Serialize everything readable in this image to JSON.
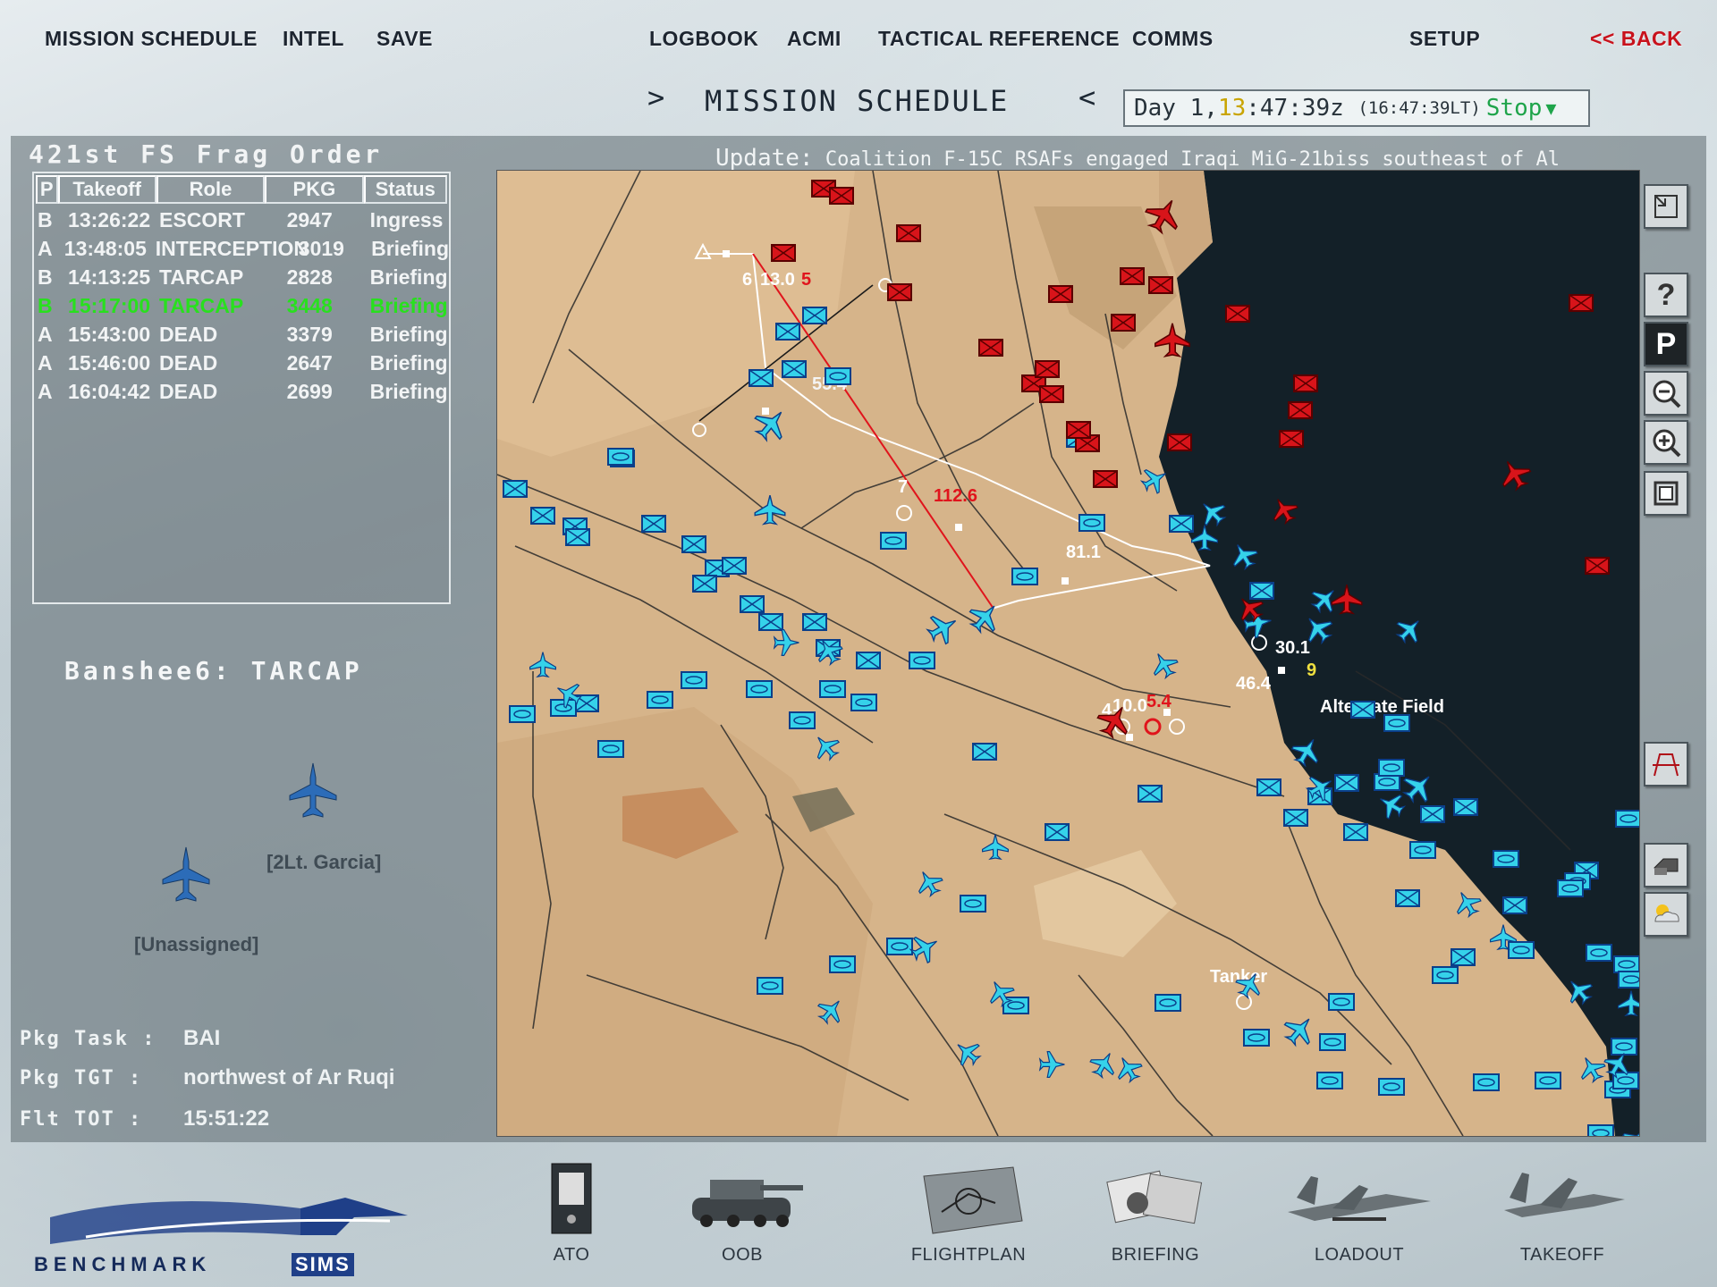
{
  "nav": {
    "mission_schedule": "MISSION SCHEDULE",
    "intel": "INTEL",
    "save": "SAVE",
    "logbook": "LOGBOOK",
    "acmi": "ACMI",
    "tactical_reference": "TACTICAL REFERENCE",
    "comms": "COMMS",
    "setup": "SETUP",
    "back": "<< BACK"
  },
  "screen_title": {
    "left_arrow": ">",
    "title": "MISSION SCHEDULE",
    "right_arrow": "<"
  },
  "clock": {
    "day_label": "Day",
    "day": "1,",
    "hour": "13",
    "rest": ":47:39z",
    "local": "(16:47:39LT)",
    "stop": "Stop"
  },
  "frag": {
    "title": "421st FS Frag Order",
    "headers": [
      "P",
      "Takeoff",
      "Role",
      "PKG",
      "Status"
    ],
    "rows": [
      {
        "p": "B",
        "takeoff": "13:26:22",
        "role": "ESCORT",
        "pkg": "2947",
        "status": "Ingress"
      },
      {
        "p": "A",
        "takeoff": "13:48:05",
        "role": "INTERCEPTION",
        "pkg": "3019",
        "status": "Briefing"
      },
      {
        "p": "B",
        "takeoff": "14:13:25",
        "role": "TARCAP",
        "pkg": "2828",
        "status": "Briefing"
      },
      {
        "p": "B",
        "takeoff": "15:17:00",
        "role": "TARCAP",
        "pkg": "3448",
        "status": "Briefing",
        "selected": true
      },
      {
        "p": "A",
        "takeoff": "15:43:00",
        "role": "DEAD",
        "pkg": "3379",
        "status": "Briefing"
      },
      {
        "p": "A",
        "takeoff": "15:46:00",
        "role": "DEAD",
        "pkg": "2647",
        "status": "Briefing"
      },
      {
        "p": "A",
        "takeoff": "16:04:42",
        "role": "DEAD",
        "pkg": "2699",
        "status": "Briefing"
      }
    ]
  },
  "flight": {
    "title": "Banshee6: TARCAP",
    "pilot1": "[2Lt. Garcia]",
    "pilot2": "[Unassigned]"
  },
  "package": {
    "task_label": "Pkg Task :",
    "task": "BAI",
    "tgt_label": "Pkg TGT  :",
    "tgt": "northwest of Ar Ruqi",
    "tot_label": "Flt TOT  :",
    "tot": "15:51:22"
  },
  "update": {
    "label": "Update:",
    "text": "Coalition F-15C RSAFs engaged Iraqi MiG-21biss southeast of Al"
  },
  "map": {
    "labels": {
      "wp6": "6",
      "wp6_alt": "13.0",
      "wp5": "5",
      "wp_b": "55.4",
      "wp7": "7",
      "red_dist": "112.6",
      "d81": "81.1",
      "d30": "30.1",
      "d46": "46.4",
      "wp9": "9",
      "wp4": "4",
      "wp4_alt": "10.0",
      "red_54": "5.4",
      "alternate": "Alternate Field",
      "tanker": "Tanker"
    },
    "colors": {
      "friendly": "#35d2ea",
      "enemy": "#d8141a",
      "sea": "#132028",
      "land": "#d6b48a"
    }
  },
  "tools": [
    "resize-icon",
    "help-icon",
    "parking-icon",
    "zoom-out-icon",
    "zoom-in-icon",
    "fit-icon",
    "threat-icon",
    "units-icon",
    "weather-icon"
  ],
  "dock": {
    "logo_text": "BENCHMARK",
    "logo_text2": "SIMS",
    "ato": "ATO",
    "oob": "OOB",
    "flightplan": "FLIGHTPLAN",
    "briefing": "BRIEFING",
    "loadout": "LOADOUT",
    "takeoff": "TAKEOFF"
  }
}
